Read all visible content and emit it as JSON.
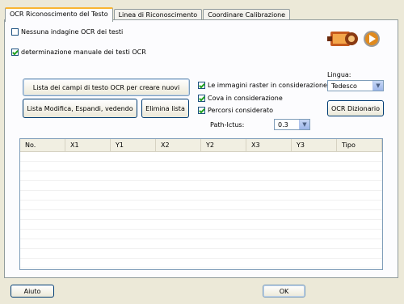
{
  "tabs": [
    {
      "label": "OCR Riconoscimento del Testo",
      "active": true
    },
    {
      "label": "Linea di Riconoscimento",
      "active": false
    },
    {
      "label": "Coordinare Calibrazione",
      "active": false
    }
  ],
  "options": {
    "no_ocr": {
      "label": "Nessuna indagine OCR dei testi",
      "checked": false
    },
    "manual_ocr": {
      "label": "determinazione manuale dei testi OCR",
      "checked": true
    }
  },
  "buttons": {
    "list_fields": "Lista dei campi di testo OCR per creare nuovi",
    "list_modify": "Lista Modifica, Espandi, vedendo",
    "delete_list": "Elimina lista",
    "ocr_dictionary": "OCR Dizionario",
    "help": "Aiuto",
    "ok": "OK"
  },
  "consider": {
    "raster": {
      "label": "Le immagini raster in considerazione",
      "checked": true
    },
    "cova": {
      "label": "Cova in considerazione",
      "checked": true
    },
    "paths": {
      "label": "Percorsi considerato",
      "checked": true
    }
  },
  "path_ictus": {
    "label": "Path-Ictus:",
    "value": "0.3"
  },
  "language": {
    "label": "Lingua:",
    "value": "Tedesco"
  },
  "table": {
    "columns": [
      "No.",
      "X1",
      "Y1",
      "X2",
      "Y2",
      "X3",
      "Y3",
      "Tipo"
    ],
    "rows": []
  },
  "icons": {
    "media": "film-reel-icon",
    "play": "play-icon"
  },
  "colors": {
    "accent_tab": "#f9b532",
    "check": "#21a121",
    "play": "#e08a1e"
  }
}
